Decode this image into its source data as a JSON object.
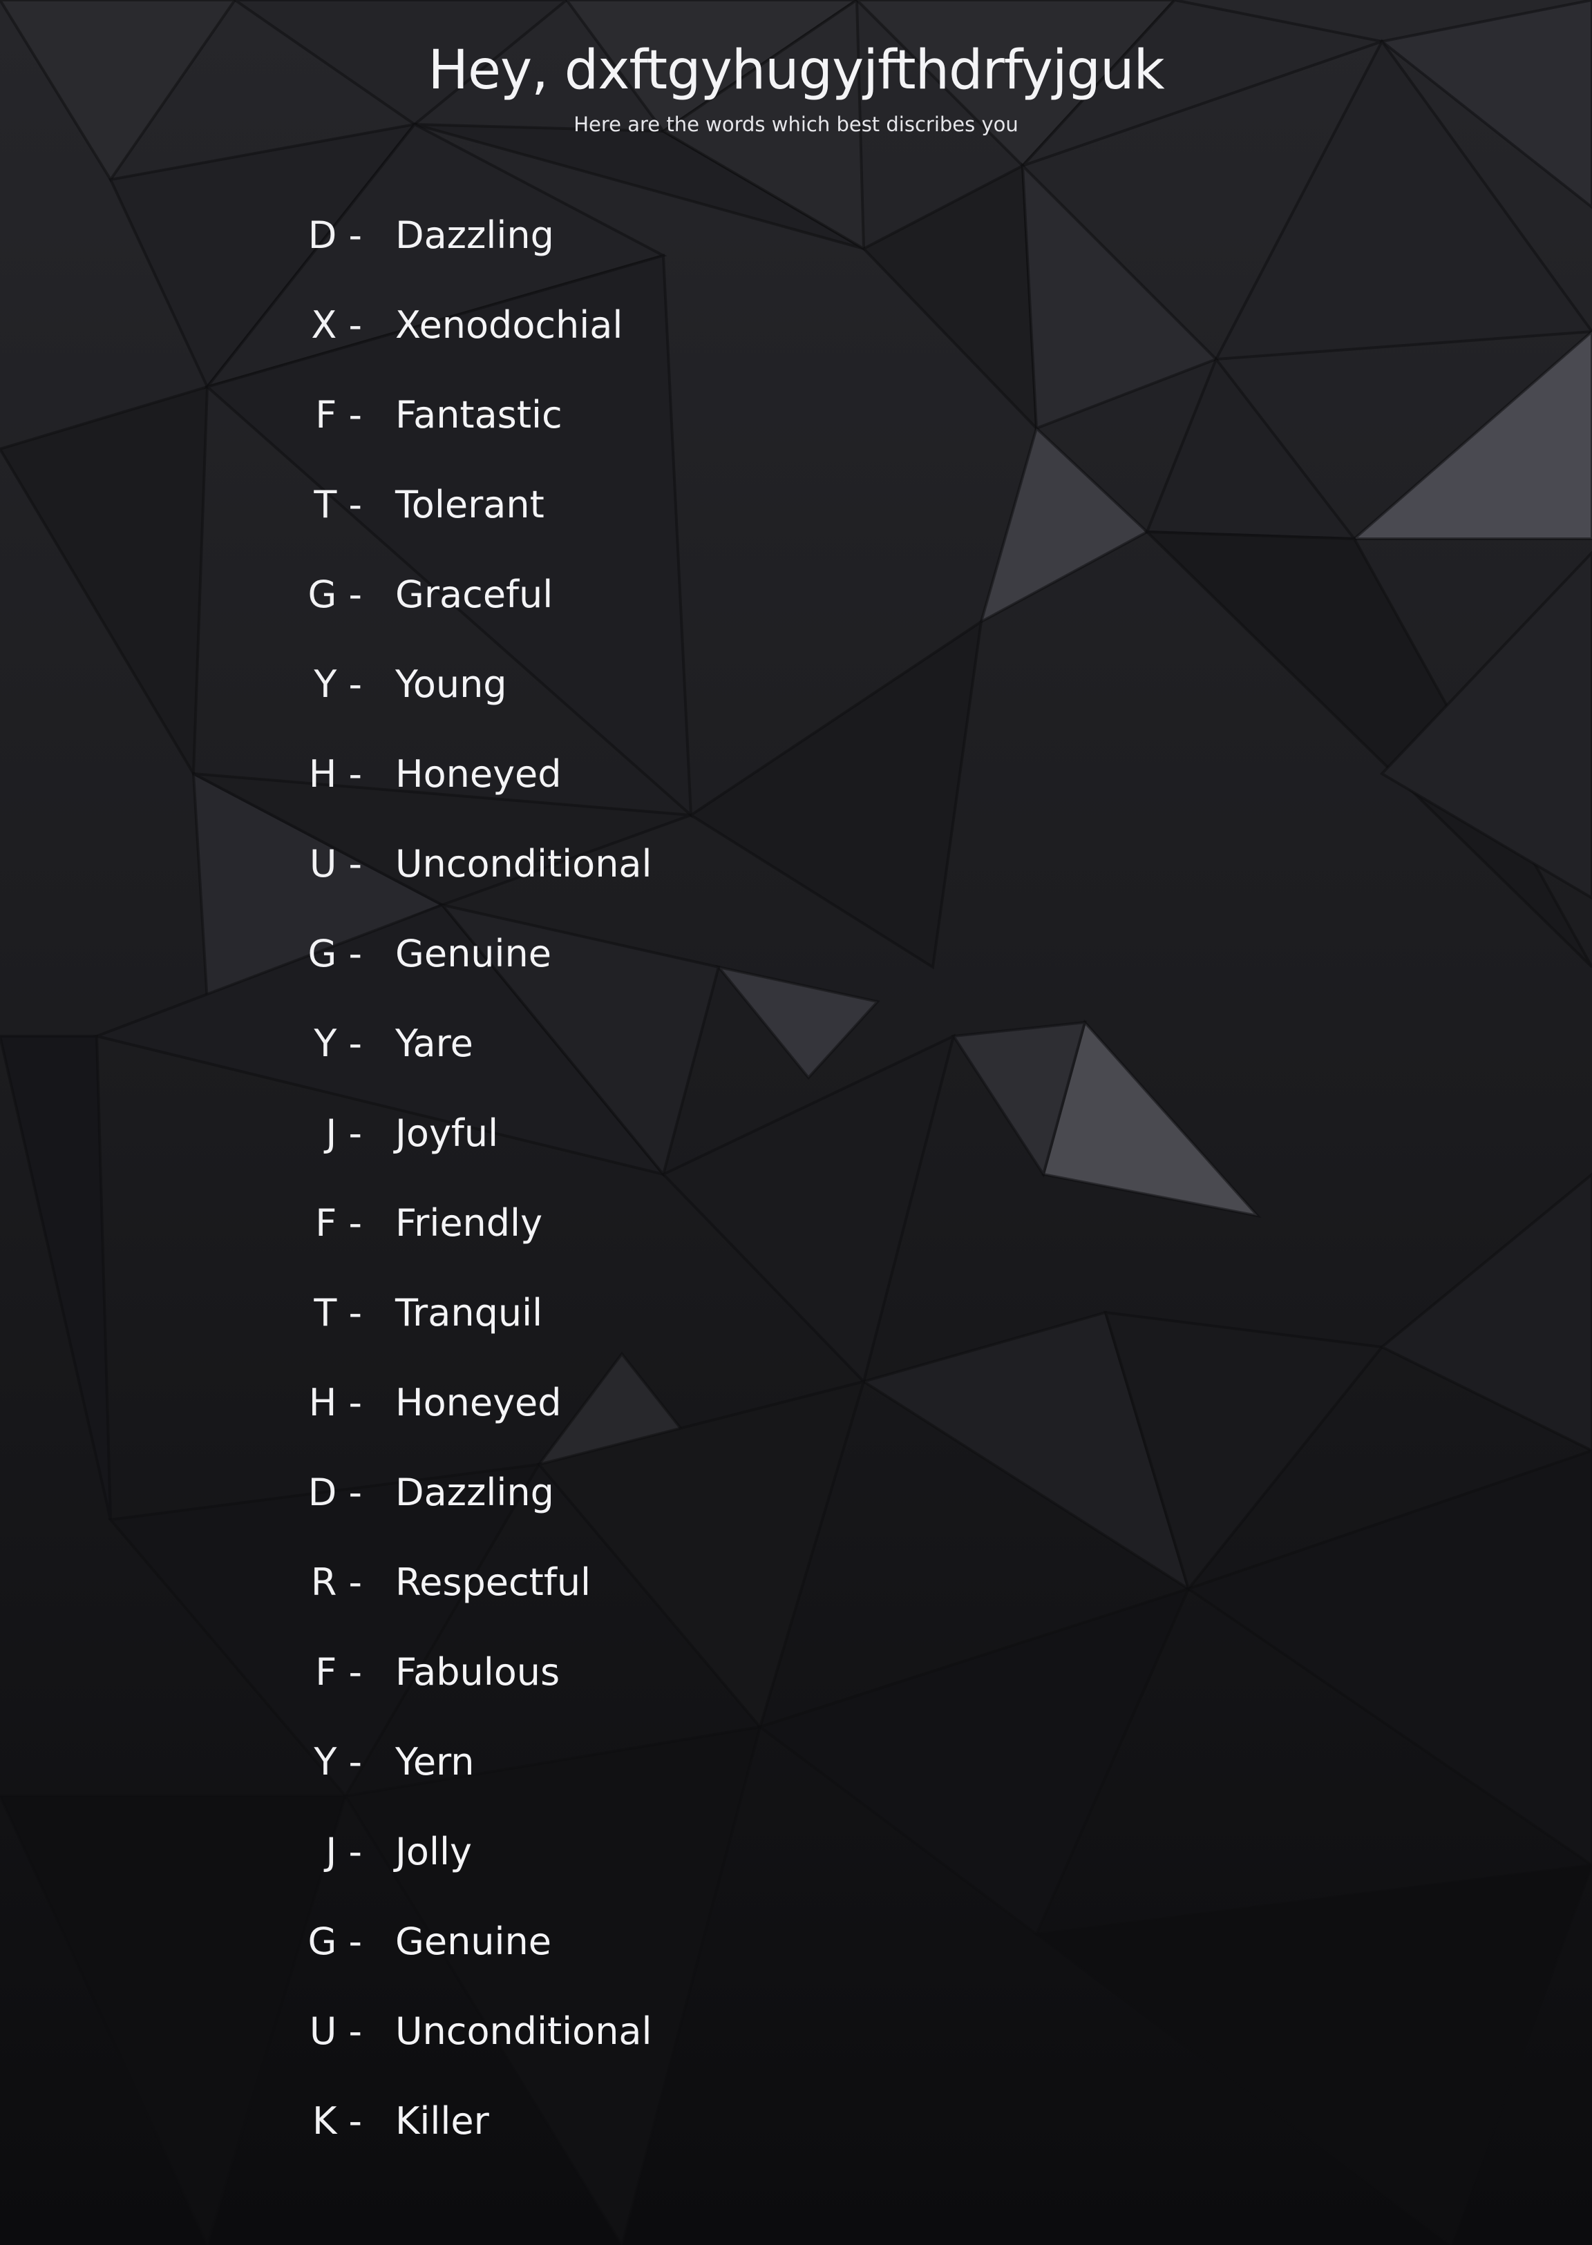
{
  "header": {
    "title": "Hey, dxftgyhugyjfthdrfyjguk",
    "subtitle": "Here are the words which best discribes you"
  },
  "words": [
    {
      "letter": "D -",
      "word": "Dazzling"
    },
    {
      "letter": "X -",
      "word": "Xenodochial"
    },
    {
      "letter": "F -",
      "word": "Fantastic"
    },
    {
      "letter": "T -",
      "word": "Tolerant"
    },
    {
      "letter": "G -",
      "word": "Graceful"
    },
    {
      "letter": "Y -",
      "word": "Young"
    },
    {
      "letter": "H -",
      "word": "Honeyed"
    },
    {
      "letter": "U -",
      "word": "Unconditional"
    },
    {
      "letter": "G -",
      "word": "Genuine"
    },
    {
      "letter": "Y -",
      "word": "Yare"
    },
    {
      "letter": "J -",
      "word": "Joyful"
    },
    {
      "letter": "F -",
      "word": "Friendly"
    },
    {
      "letter": "T -",
      "word": "Tranquil"
    },
    {
      "letter": "H -",
      "word": "Honeyed"
    },
    {
      "letter": "D -",
      "word": "Dazzling"
    },
    {
      "letter": "R -",
      "word": "Respectful"
    },
    {
      "letter": "F -",
      "word": "Fabulous"
    },
    {
      "letter": "Y -",
      "word": "Yern"
    },
    {
      "letter": "J -",
      "word": "Jolly"
    },
    {
      "letter": "G -",
      "word": "Genuine"
    },
    {
      "letter": "U -",
      "word": "Unconditional"
    },
    {
      "letter": "K -",
      "word": "Killer"
    }
  ],
  "colors": {
    "background": "#121214",
    "text": "#f4f4f6"
  }
}
